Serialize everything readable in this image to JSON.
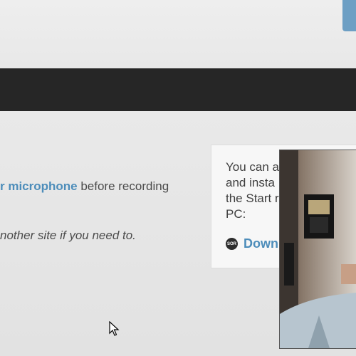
{
  "content": {
    "line1_link": "r microphone",
    "line1_rest": " before recording",
    "line2": "nother site if you need to."
  },
  "side_panel": {
    "lines": [
      "You can a",
      "and insta",
      "the Start r",
      "PC:"
    ],
    "download_icon_text": "SOR",
    "download_label": "Down"
  },
  "colors": {
    "link": "#4d8dba",
    "dark_bar": "#262626",
    "top_button": "#6d9fc4"
  },
  "icons": {
    "download": "download-app-icon",
    "cursor": "mouse-pointer-icon"
  }
}
